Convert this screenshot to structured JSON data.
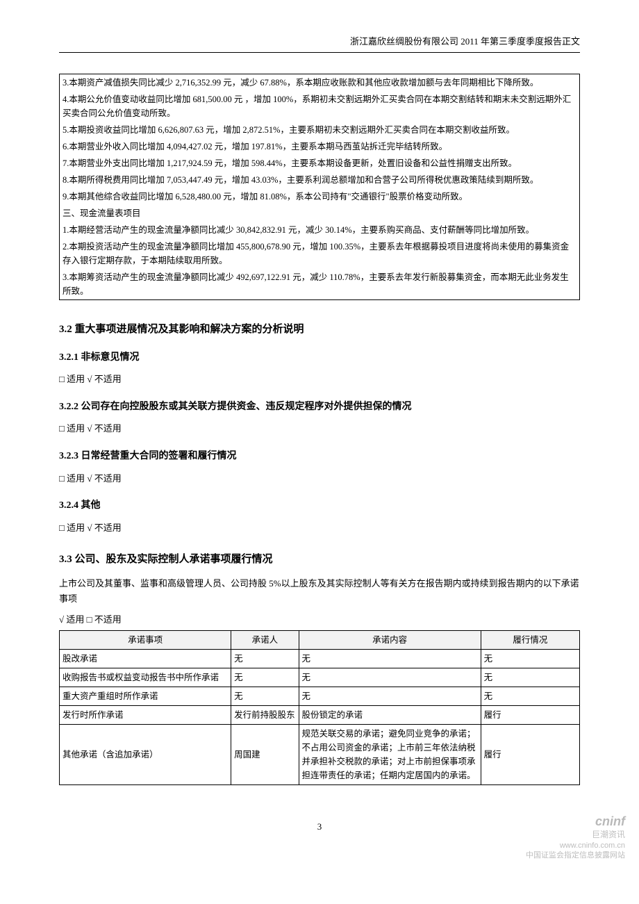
{
  "header": "浙江嘉欣丝绸股份有限公司 2011 年第三季度季度报告正文",
  "notes": [
    "3.本期资产减值损失同比减少 2,716,352.99 元，减少 67.88%，系本期应收账款和其他应收款增加额与去年同期相比下降所致。",
    "4.本期公允价值变动收益同比增加 681,500.00 元 ，增加 100%，系期初未交割远期外汇买卖合同在本期交割结转和期末未交割远期外汇买卖合同公允价值变动所致。",
    "5.本期投资收益同比增加 6,626,807.63 元，增加 2,872.51%，主要系期初未交割远期外汇买卖合同在本期交割收益所致。",
    "6.本期营业外收入同比增加 4,094,427.02 元，增加 197.81%，主要系本期马西茧站拆迁完毕结转所致。",
    "7.本期营业外支出同比增加 1,217,924.59 元，增加 598.44%，主要系本期设备更新，处置旧设备和公益性捐赠支出所致。",
    "8.本期所得税费用同比增加 7,053,447.49 元，增加 43.03%，主要系利润总额增加和合营子公司所得税优惠政策陆续到期所致。",
    "9.本期其他综合收益同比增加 6,528,480.00 元，增加 81.08%，系本公司持有\"交通银行\"股票价格变动所致。",
    "三、现金流量表项目",
    "1.本期经营活动产生的现金流量净额同比减少 30,842,832.91 元，减少 30.14%，主要系购买商品、支付薪酬等同比增加所致。",
    "2.本期投资活动产生的现金流量净额同比增加 455,800,678.90 元，增加 100.35%，主要系去年根据募投项目进度将尚未使用的募集资金存入银行定期存款，于本期陆续取用所致。",
    "3.本期筹资活动产生的现金流量净额同比减少 492,697,122.91 元，减少 110.78%，主要系去年发行新股募集资金，而本期无此业务发生所致。"
  ],
  "section32": "3.2 重大事项进展情况及其影响和解决方案的分析说明",
  "sub321": {
    "title": "3.2.1 非标意见情况",
    "status": "□ 适用 √ 不适用"
  },
  "sub322": {
    "title": "3.2.2 公司存在向控股股东或其关联方提供资金、违反规定程序对外提供担保的情况",
    "status": "□ 适用 √ 不适用"
  },
  "sub323": {
    "title": "3.2.3 日常经营重大合同的签署和履行情况",
    "status": "□ 适用 √ 不适用"
  },
  "sub324": {
    "title": "3.2.4 其他",
    "status": "□ 适用 √ 不适用"
  },
  "section33": {
    "title": "3.3 公司、股东及实际控制人承诺事项履行情况",
    "intro": "上市公司及其董事、监事和高级管理人员、公司持股 5%以上股东及其实际控制人等有关方在报告期内或持续到报告期内的以下承诺事项",
    "status": "√ 适用 □ 不适用",
    "headers": {
      "item": "承诺事项",
      "person": "承诺人",
      "content": "承诺内容",
      "fulfil": "履行情况"
    },
    "rows": [
      {
        "item": "股改承诺",
        "person": "无",
        "content": "无",
        "status": "无"
      },
      {
        "item": "收购报告书或权益变动报告书中所作承诺",
        "person": "无",
        "content": "无",
        "status": "无"
      },
      {
        "item": "重大资产重组时所作承诺",
        "person": "无",
        "content": "无",
        "status": "无"
      },
      {
        "item": "发行时所作承诺",
        "person": "发行前持股股东",
        "content": "股份锁定的承诺",
        "status": "履行"
      },
      {
        "item": "其他承诺（含追加承诺）",
        "person": "周国建",
        "content": "规范关联交易的承诺；避免同业竞争的承诺；不占用公司资金的承诺；上市前三年依法纳税并承担补交税款的承诺；对上市前担保事项承担连带责任的承诺；任期内定居国内的承诺。",
        "status": "履行"
      }
    ]
  },
  "pageNumber": "3",
  "watermark": {
    "logo": "cninf",
    "cn": "巨潮资讯",
    "url": "www.cninfo.com.cn",
    "desc": "中国证监会指定信息披露网站"
  }
}
